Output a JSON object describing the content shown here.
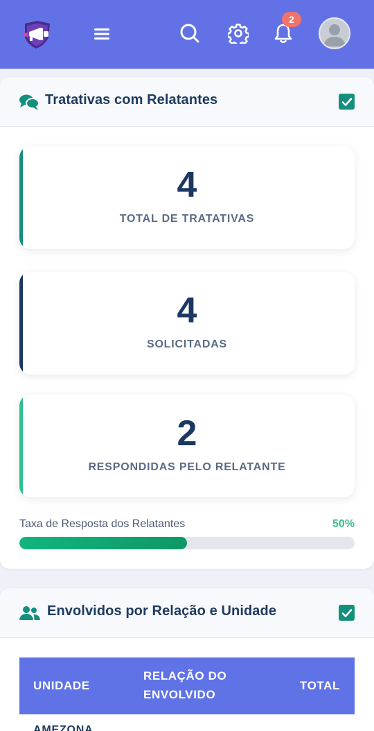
{
  "header": {
    "logo_icon": "megaphone-shield-icon",
    "menu_icon": "hamburger-icon",
    "search_icon": "search-icon",
    "settings_icon": "gear-icon",
    "notifications_icon": "bell-icon",
    "notification_count": "2",
    "avatar_icon": "user-avatar-icon",
    "bar_color": "#6271e6"
  },
  "tratativas": {
    "icon": "chat-bubbles-icon",
    "title": "Tratativas com Relatantes",
    "checked": true,
    "stats": [
      {
        "value": "4",
        "label": "TOTAL DE TRATATIVAS",
        "accent": "#13907d"
      },
      {
        "value": "4",
        "label": "SOLICITADAS",
        "accent": "#1c3862"
      },
      {
        "value": "2",
        "label": "RESPONDIDAS PELO RELATANTE",
        "accent": "#2fc08f"
      }
    ],
    "response_rate": {
      "label": "Taxa de Resposta dos Relatantes",
      "percent_text": "50%",
      "fraction": 0.5
    }
  },
  "envolvidos": {
    "icon": "users-icon",
    "title": "Envolvidos por Relação e Unidade",
    "checked": true,
    "table": {
      "columns": [
        "UNIDADE",
        "RELAÇÃO DO ENVOLVIDO",
        "TOTAL"
      ],
      "column_lines": [
        [
          "UNIDADE"
        ],
        [
          "RELAÇÃO DO",
          "ENVOLVIDO"
        ],
        [
          "TOTAL"
        ]
      ],
      "rows": [
        {
          "unidade": "AMEZONA"
        }
      ]
    }
  }
}
